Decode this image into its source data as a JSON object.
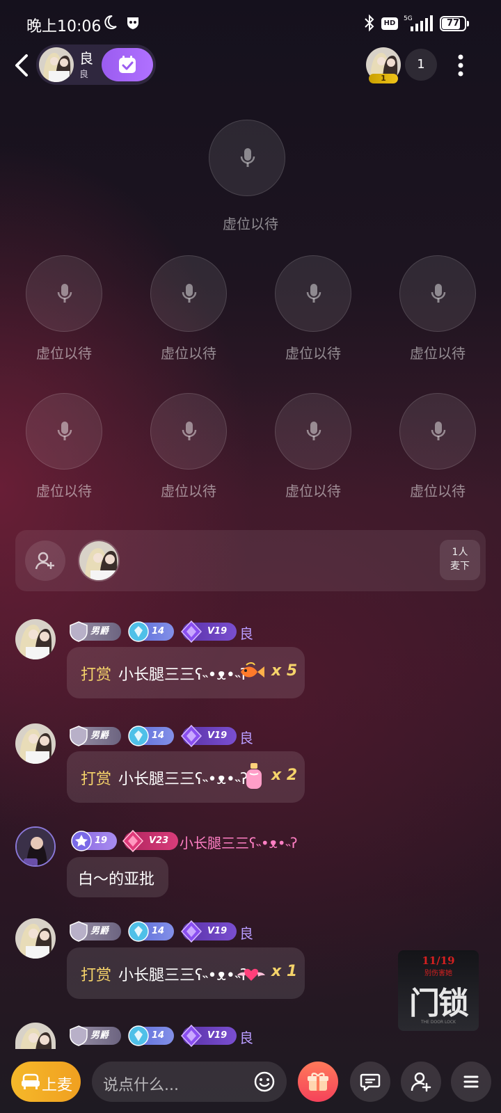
{
  "status_bar": {
    "time": "晚上10:06",
    "hd": "HD",
    "network": "5G",
    "battery": "77"
  },
  "header": {
    "room_name": "良",
    "room_sub": "良",
    "top_rank": "1",
    "online_count": "1"
  },
  "seats": {
    "host_label": "虚位以待",
    "labels": [
      "虚位以待",
      "虚位以待",
      "虚位以待",
      "虚位以待",
      "虚位以待",
      "虚位以待",
      "虚位以待",
      "虚位以待"
    ]
  },
  "waiting": {
    "count": "1人",
    "label": "麦下"
  },
  "messages": [
    {
      "badge_duke": "男爵",
      "badge_level": "14",
      "badge_vip": "V19",
      "nick": "良",
      "gift_word": "打赏",
      "target": "小长腿三三ʕ˵•ᴥ•˵ʔ",
      "gift_icon": "goldfish-gift-icon",
      "mult": "x 5"
    },
    {
      "badge_duke": "男爵",
      "badge_level": "14",
      "badge_vip": "V19",
      "nick": "良",
      "gift_word": "打赏",
      "target": "小长腿三三ʕ˵•ᴥ•˵ʔ",
      "gift_icon": "perfume-gift-icon",
      "mult": "x 2"
    },
    {
      "badge_level": "19",
      "badge_vip": "V23",
      "nick": "小长腿三三ʕ˵•ᴥ•˵ʔ",
      "text": "白～的亚批"
    },
    {
      "badge_duke": "男爵",
      "badge_level": "14",
      "badge_vip": "V19",
      "nick": "良",
      "gift_word": "打赏",
      "target": "小长腿三三ʕ˵•ᴥ•˵ʔ",
      "gift_icon": "winged-heart-gift-icon",
      "mult": "x 1"
    },
    {
      "badge_duke": "男爵",
      "badge_level": "14",
      "badge_vip": "V19",
      "nick": "良"
    }
  ],
  "ad": {
    "date": "11/19",
    "subtitle": "别伤害她",
    "title": "门锁",
    "english": "THE DOOR LOCK"
  },
  "bottom_bar": {
    "mic_up": "上麦",
    "input_placeholder": "说点什么..."
  },
  "colors": {
    "accent_purple": "#a96cf8",
    "gold": "#f5d36a",
    "pink_nick": "#ff7fc4",
    "nick_purple": "#b99cff"
  }
}
